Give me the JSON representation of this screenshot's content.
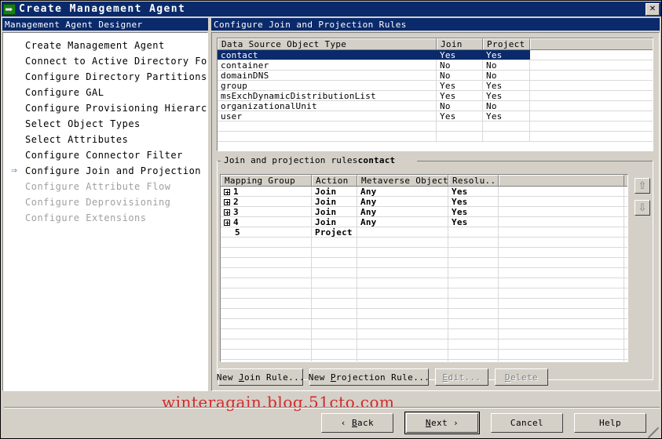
{
  "window": {
    "title": "Create Management Agent",
    "icon": "management-agent-icon",
    "close_label": "✕"
  },
  "left_panel": {
    "header": "Management Agent Designer",
    "steps": [
      {
        "label": "Create Management Agent",
        "state": "done"
      },
      {
        "label": "Connect to Active Directory Forest",
        "state": "done"
      },
      {
        "label": "Configure Directory Partitions",
        "state": "done"
      },
      {
        "label": "Configure GAL",
        "state": "done"
      },
      {
        "label": "Configure Provisioning Hierarchy",
        "state": "done"
      },
      {
        "label": "Select Object Types",
        "state": "done"
      },
      {
        "label": "Select Attributes",
        "state": "done"
      },
      {
        "label": "Configure Connector Filter",
        "state": "done"
      },
      {
        "label": "Configure Join and Projection Rules",
        "state": "current"
      },
      {
        "label": "Configure Attribute Flow",
        "state": "disabled"
      },
      {
        "label": "Configure Deprovisioning",
        "state": "disabled"
      },
      {
        "label": "Configure Extensions",
        "state": "disabled"
      }
    ]
  },
  "right_panel": {
    "header": "Configure Join and Projection Rules",
    "object_type_table": {
      "columns": [
        "Data Source Object Type",
        "Join",
        "Project",
        ""
      ],
      "rows": [
        {
          "type": "contact",
          "join": "Yes",
          "project": "Yes",
          "blank": "",
          "selected": true
        },
        {
          "type": "container",
          "join": "No",
          "project": "No",
          "blank": "",
          "selected": false
        },
        {
          "type": "domainDNS",
          "join": "No",
          "project": "No",
          "blank": "",
          "selected": false
        },
        {
          "type": "group",
          "join": "Yes",
          "project": "Yes",
          "blank": "",
          "selected": false
        },
        {
          "type": "msExchDynamicDistributionList",
          "join": "Yes",
          "project": "Yes",
          "blank": "",
          "selected": false
        },
        {
          "type": "organizationalUnit",
          "join": "No",
          "project": "No",
          "blank": "",
          "selected": false
        },
        {
          "type": "user",
          "join": "Yes",
          "project": "Yes",
          "blank": "",
          "selected": false
        },
        {
          "type": "",
          "join": "",
          "project": "",
          "blank": "",
          "selected": false
        },
        {
          "type": "",
          "join": "",
          "project": "",
          "blank": "",
          "selected": false
        }
      ]
    },
    "rules_group": {
      "title_prefix": "Join and projection rules",
      "title_object": "contact",
      "columns": [
        "Mapping Group",
        "Action",
        "Metaverse Object...",
        "Resolu...",
        ""
      ],
      "rows": [
        {
          "group": "1",
          "expandable": true,
          "action": "Join",
          "metaverse": "Any",
          "resolution": "Yes"
        },
        {
          "group": "2",
          "expandable": true,
          "action": "Join",
          "metaverse": "Any",
          "resolution": "Yes"
        },
        {
          "group": "3",
          "expandable": true,
          "action": "Join",
          "metaverse": "Any",
          "resolution": "Yes"
        },
        {
          "group": "4",
          "expandable": true,
          "action": "Join",
          "metaverse": "Any",
          "resolution": "Yes"
        },
        {
          "group": "5",
          "expandable": false,
          "action": "Project",
          "metaverse": "",
          "resolution": ""
        }
      ],
      "move_up_label": "⇧",
      "move_down_label": "⇩"
    },
    "rule_buttons": [
      {
        "name": "new-join-rule-button",
        "pre": "New ",
        "accel": "J",
        "post": "oin Rule...",
        "enabled": true
      },
      {
        "name": "new-projection-rule-button",
        "pre": "New ",
        "accel": "P",
        "post": "rojection Rule...",
        "enabled": true
      },
      {
        "name": "edit-button",
        "pre": "",
        "accel": "E",
        "post": "dit...",
        "enabled": false
      },
      {
        "name": "delete-button",
        "pre": "",
        "accel": "D",
        "post": "elete",
        "enabled": false
      }
    ]
  },
  "footer": {
    "watermark": "winteragain.blog.51cto.com",
    "buttons": [
      {
        "name": "back-button",
        "pre": "‹  ",
        "accel": "B",
        "post": "ack",
        "focused": false
      },
      {
        "name": "next-button",
        "pre": "",
        "accel": "N",
        "post": "ext  ›",
        "focused": true
      },
      {
        "name": "cancel-button",
        "pre": "Cancel",
        "accel": "",
        "post": "",
        "focused": false
      },
      {
        "name": "help-button",
        "pre": "Help",
        "accel": "",
        "post": "",
        "focused": false
      }
    ]
  },
  "colors": {
    "titlebar": "#0a2a6b",
    "face": "#d4d0c8",
    "selection": "#0a2a6b",
    "watermark": "#d42a2a",
    "disabled_text": "#808080"
  }
}
